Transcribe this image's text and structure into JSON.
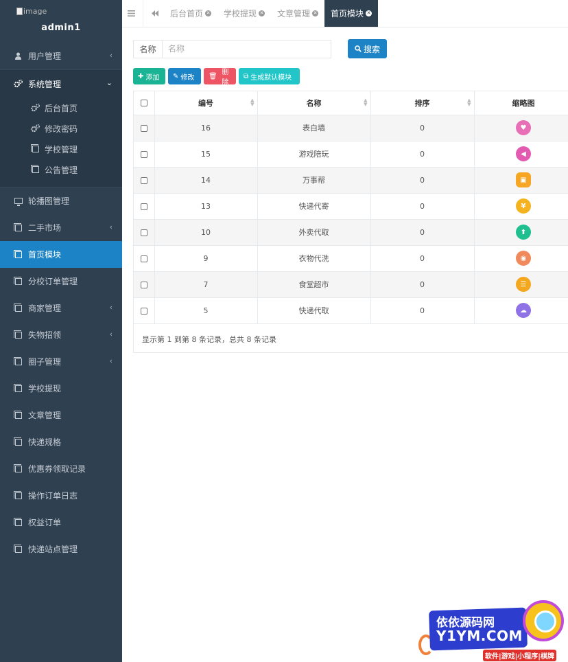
{
  "sidebar": {
    "avatar_alt": "image",
    "username": "admin1",
    "groups": {
      "user_mgmt": "用户管理",
      "system_mgmt": "系统管理"
    },
    "sub_items": [
      "后台首页",
      "修改密码",
      "学校管理",
      "公告管理"
    ],
    "items": [
      "轮播图管理",
      "二手市场",
      "首页模块",
      "分校订单管理",
      "商家管理",
      "失物招领",
      "圈子管理",
      "学校提现",
      "文章管理",
      "快递规格",
      "优惠券领取记录",
      "操作订单日志",
      "权益订单",
      "快递站点管理"
    ]
  },
  "tabs": [
    "后台首页",
    "学校提现",
    "文章管理",
    "首页模块"
  ],
  "search": {
    "label": "名称",
    "placeholder": "名称",
    "button": "搜索"
  },
  "toolbar": {
    "add": "添加",
    "edit": "修改",
    "delete": "删除",
    "generate": "生成默认模块"
  },
  "table": {
    "headers": [
      "编号",
      "名称",
      "排序",
      "缩略图"
    ],
    "rows": [
      {
        "id": "16",
        "name": "表白墙",
        "sort": "0",
        "thumb_color": "#e86fb6"
      },
      {
        "id": "15",
        "name": "游戏陪玩",
        "sort": "0",
        "thumb_color": "#e25bb0"
      },
      {
        "id": "14",
        "name": "万事帮",
        "sort": "0",
        "thumb_color": "#f6a623"
      },
      {
        "id": "13",
        "name": "快递代寄",
        "sort": "0",
        "thumb_color": "#f5b321"
      },
      {
        "id": "10",
        "name": "外卖代取",
        "sort": "0",
        "thumb_color": "#1fbf8f"
      },
      {
        "id": "9",
        "name": "衣物代洗",
        "sort": "0",
        "thumb_color": "#f08a5d"
      },
      {
        "id": "7",
        "name": "食堂超市",
        "sort": "0",
        "thumb_color": "#f4a81f"
      },
      {
        "id": "5",
        "name": "快递代取",
        "sort": "0",
        "thumb_color": "#8f72e6"
      }
    ]
  },
  "pager_text": "显示第 1 到第 8 条记录，总共 8 条记录",
  "watermark": {
    "line1": "依依源码网",
    "line2": "Y1YM.COM",
    "line3": "软件|游戏|小程序|棋牌"
  }
}
